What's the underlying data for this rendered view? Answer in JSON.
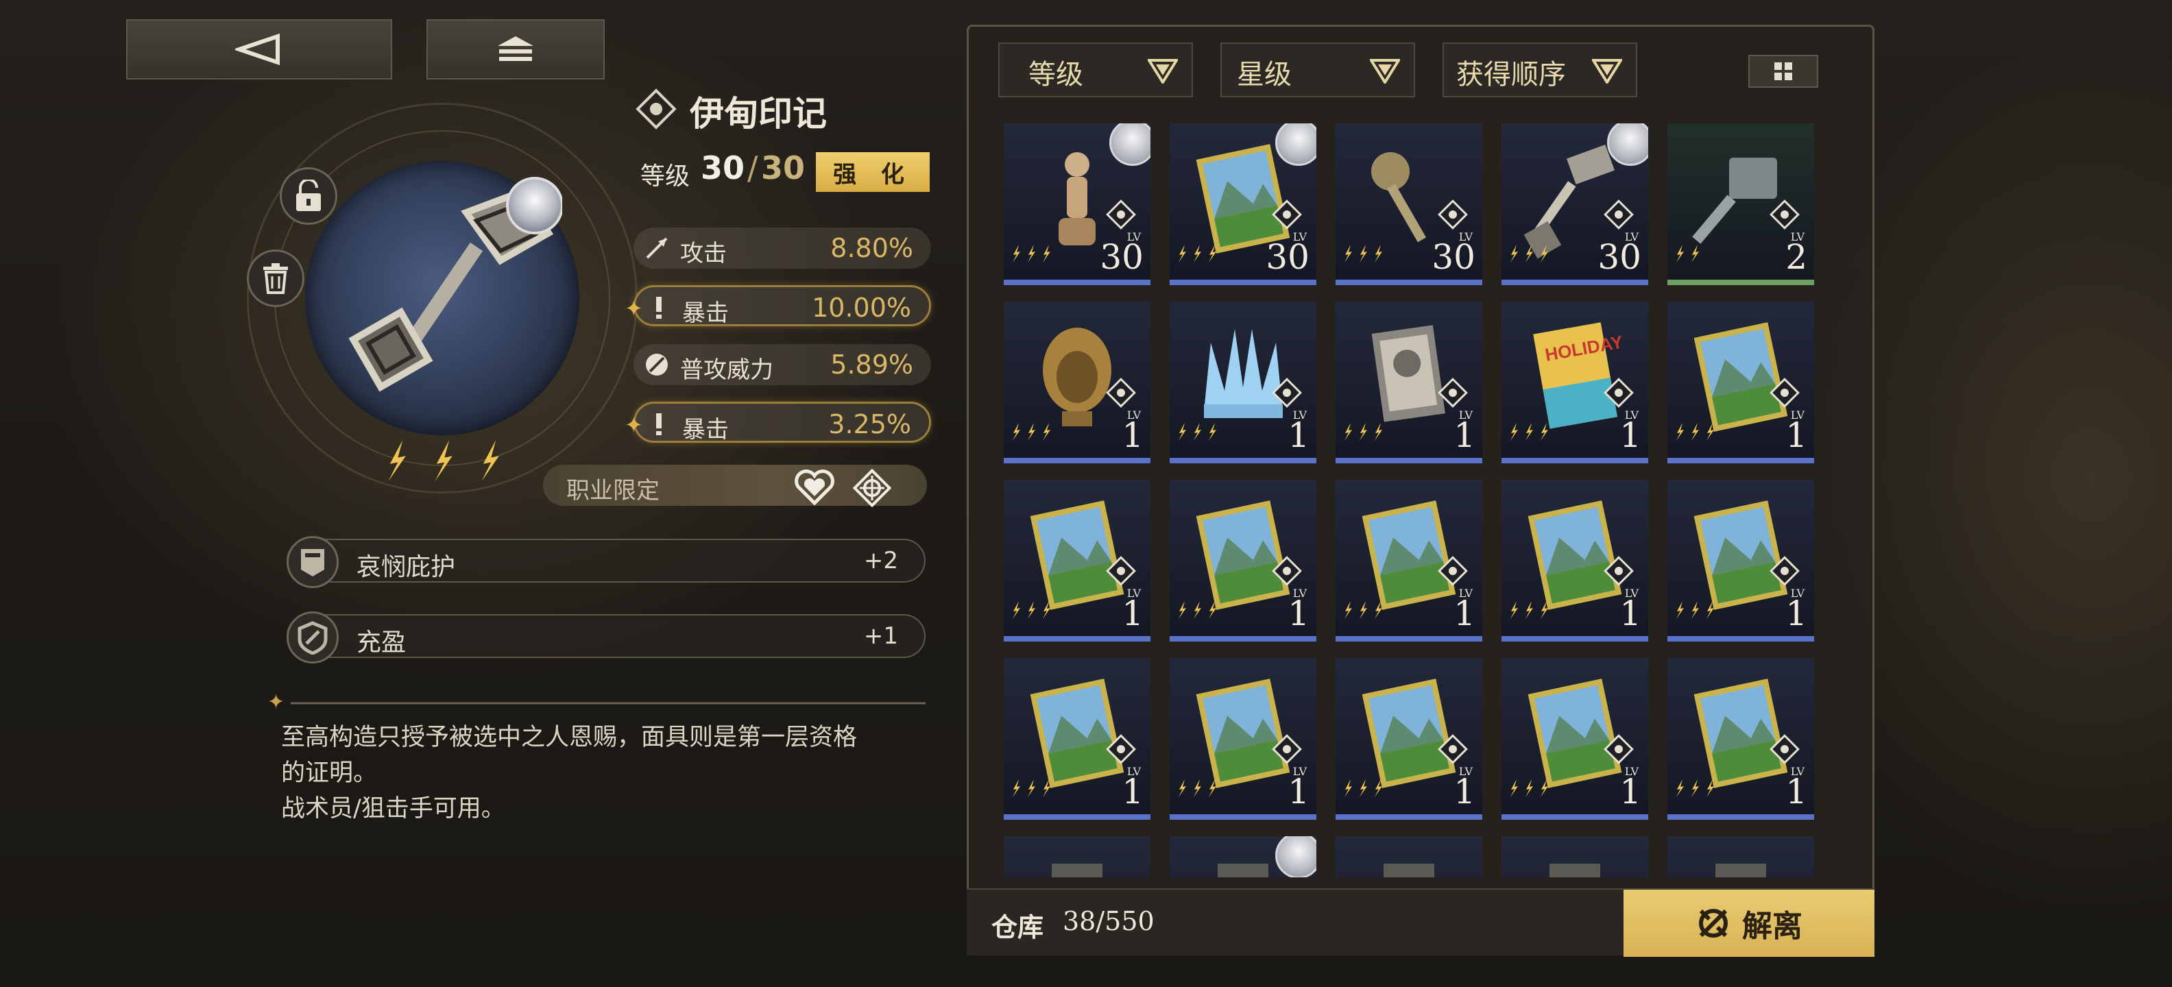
{
  "item": {
    "name": "伊甸印记",
    "level_label": "等级",
    "level": "30",
    "level_sep": "/",
    "level_max": "30",
    "upgrade_label": "强 化",
    "stars": 3,
    "main_stat": {
      "name": "攻击",
      "value": "8.80%"
    },
    "sub_stats": [
      {
        "name": "暴击",
        "value": "10.00%",
        "highlighted": true
      },
      {
        "name": "普攻威力",
        "value": "5.89%",
        "highlighted": false
      },
      {
        "name": "暴击",
        "value": "3.25%",
        "highlighted": true
      }
    ],
    "job_label": "职业限定",
    "job_icons": [
      "tactician-icon",
      "sniper-icon"
    ],
    "skills": [
      {
        "name": "哀悯庇护",
        "value": "+2",
        "icon": "shield-helm-icon"
      },
      {
        "name": "充盈",
        "value": "+1",
        "icon": "shield-icon"
      }
    ],
    "description": [
      "至高构造只授予被选中之人恩赐，面具则是第一层资格",
      "的证明。",
      "战术员/狙击手可用。"
    ]
  },
  "sort_options": [
    {
      "label": "等级"
    },
    {
      "label": "星级"
    },
    {
      "label": "获得顺序"
    }
  ],
  "inventory": {
    "storage_label": "仓库",
    "storage_count": "38/550",
    "dismantle_label": "解离",
    "lv_tag": "LV",
    "items": [
      {
        "name": "wooden-mannequin",
        "level": "30",
        "stars": 3,
        "bar": "blue",
        "portrait": true,
        "bg": "#23283b"
      },
      {
        "name": "landscape-painting",
        "level": "30",
        "stars": 3,
        "bar": "blue",
        "portrait": true,
        "bg": "#23283b"
      },
      {
        "name": "ornate-key",
        "level": "30",
        "stars": 3,
        "bar": "blue",
        "portrait": false,
        "bg": "#23283b"
      },
      {
        "name": "eden-mark-key",
        "level": "30",
        "stars": 3,
        "bar": "blue",
        "portrait": true,
        "bg": "#23283b",
        "selected": true
      },
      {
        "name": "grey-key",
        "level": "2",
        "stars": 2,
        "bar": "green",
        "portrait": false,
        "bg": "#22302a"
      },
      {
        "name": "golden-mask",
        "level": "1",
        "stars": 3,
        "bar": "blue",
        "portrait": false,
        "bg": "#23283b"
      },
      {
        "name": "ice-crown",
        "level": "1",
        "stars": 3,
        "bar": "blue",
        "portrait": false,
        "bg": "#23283b"
      },
      {
        "name": "portrait-book",
        "level": "1",
        "stars": 3,
        "bar": "blue",
        "portrait": false,
        "bg": "#23283b"
      },
      {
        "name": "holiday-magazine",
        "level": "1",
        "stars": 3,
        "bar": "blue",
        "portrait": false,
        "bg": "#23283b"
      },
      {
        "name": "landscape-painting",
        "level": "1",
        "stars": 3,
        "bar": "blue",
        "portrait": false,
        "bg": "#23283b"
      },
      {
        "name": "landscape-painting",
        "level": "1",
        "stars": 3,
        "bar": "blue",
        "portrait": false,
        "bg": "#23283b"
      },
      {
        "name": "landscape-painting",
        "level": "1",
        "stars": 3,
        "bar": "blue",
        "portrait": false,
        "bg": "#23283b"
      },
      {
        "name": "landscape-painting",
        "level": "1",
        "stars": 3,
        "bar": "blue",
        "portrait": false,
        "bg": "#23283b"
      },
      {
        "name": "landscape-painting",
        "level": "1",
        "stars": 3,
        "bar": "blue",
        "portrait": false,
        "bg": "#23283b"
      },
      {
        "name": "landscape-painting",
        "level": "1",
        "stars": 3,
        "bar": "blue",
        "portrait": false,
        "bg": "#23283b"
      },
      {
        "name": "landscape-painting",
        "level": "1",
        "stars": 3,
        "bar": "blue",
        "portrait": false,
        "bg": "#23283b"
      },
      {
        "name": "landscape-painting",
        "level": "1",
        "stars": 3,
        "bar": "blue",
        "portrait": false,
        "bg": "#23283b"
      },
      {
        "name": "landscape-painting",
        "level": "1",
        "stars": 3,
        "bar": "blue",
        "portrait": false,
        "bg": "#23283b"
      },
      {
        "name": "landscape-painting",
        "level": "1",
        "stars": 3,
        "bar": "blue",
        "portrait": false,
        "bg": "#23283b"
      },
      {
        "name": "landscape-painting",
        "level": "1",
        "stars": 3,
        "bar": "blue",
        "portrait": false,
        "bg": "#23283b"
      },
      {
        "name": "partial-item",
        "level": "",
        "stars": 0,
        "bar": "blue",
        "portrait": false,
        "bg": "#23283b"
      },
      {
        "name": "partial-item",
        "level": "",
        "stars": 0,
        "bar": "blue",
        "portrait": true,
        "bg": "#23283b"
      },
      {
        "name": "partial-item",
        "level": "",
        "stars": 0,
        "bar": "blue",
        "portrait": false,
        "bg": "#23283b"
      },
      {
        "name": "partial-item",
        "level": "",
        "stars": 0,
        "bar": "blue",
        "portrait": false,
        "bg": "#23283b"
      },
      {
        "name": "partial-item",
        "level": "",
        "stars": 0,
        "bar": "blue",
        "portrait": false,
        "bg": "#23283b"
      }
    ]
  },
  "colors": {
    "accent_gold": "#d9b766",
    "button_gold": "#e2bd5c",
    "bar_blue": "#5a73c8",
    "bar_green": "#6da060"
  }
}
